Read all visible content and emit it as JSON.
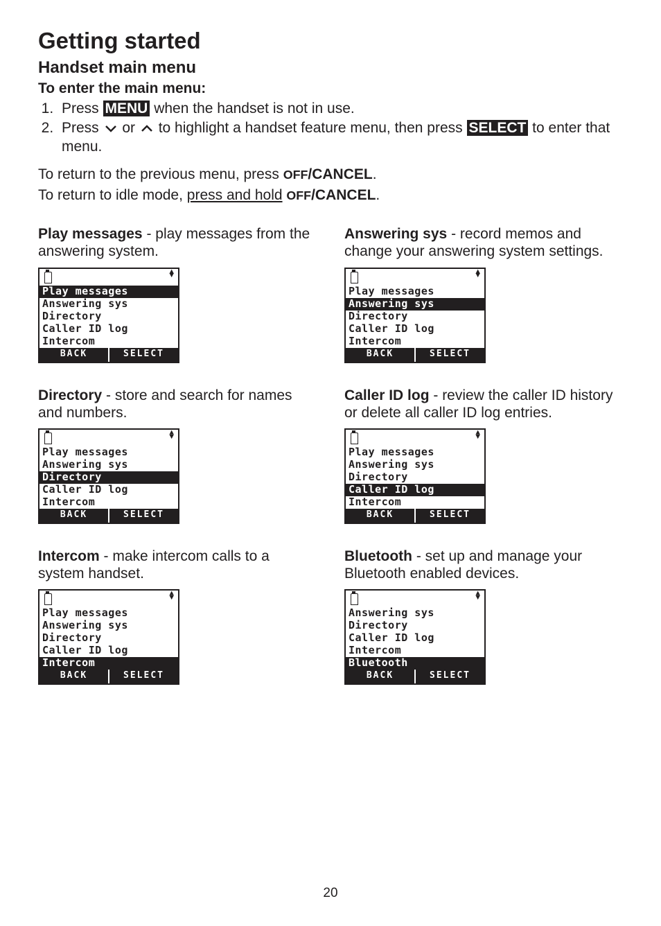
{
  "page": {
    "title": "Getting started",
    "subtitle": "Handset main menu",
    "sectiontitle": "To enter the main menu:",
    "step1_a": "Press ",
    "step1_menu": "MENU",
    "step1_b": " when the handset is not in use.",
    "step2_a": "Press ",
    "step2_b": " or ",
    "step2_c": " to highlight a handset feature menu, then press ",
    "step2_select": "SELECT",
    "step2_d": " to enter that menu.",
    "ret1_a": "To return to the previous menu, press ",
    "ret1_off": "OFF",
    "ret1_b": "/CANCEL",
    "ret1_c": ".",
    "ret2_a": "To return to idle mode, ",
    "ret2_u": "press and hold",
    "ret2_b": " ",
    "ret2_off": "OFF",
    "ret2_c": "/CANCEL",
    "ret2_d": ".",
    "pagenum": "20"
  },
  "sections": {
    "play": {
      "title": "Play messages",
      "desc": " - play messages from the answering system."
    },
    "ans": {
      "title": "Answering sys",
      "desc": " - record memos and change your answering system settings."
    },
    "dir": {
      "title": "Directory",
      "desc": " - store and search for names and numbers."
    },
    "cid": {
      "title": "Caller ID log",
      "desc": " - review the caller ID history or delete all caller ID log entries."
    },
    "int": {
      "title": "Intercom",
      "desc": " - make intercom calls to a system handset."
    },
    "bt": {
      "title": "Bluetooth",
      "desc": " - set up and manage your Bluetooth enabled devices."
    }
  },
  "menu": {
    "play": "Play messages",
    "ans": "Answering sys",
    "dir": "Directory",
    "cid": "Caller ID log",
    "int": "Intercom",
    "bt": "Bluetooth",
    "back": "BACK",
    "select": "SELECT"
  }
}
